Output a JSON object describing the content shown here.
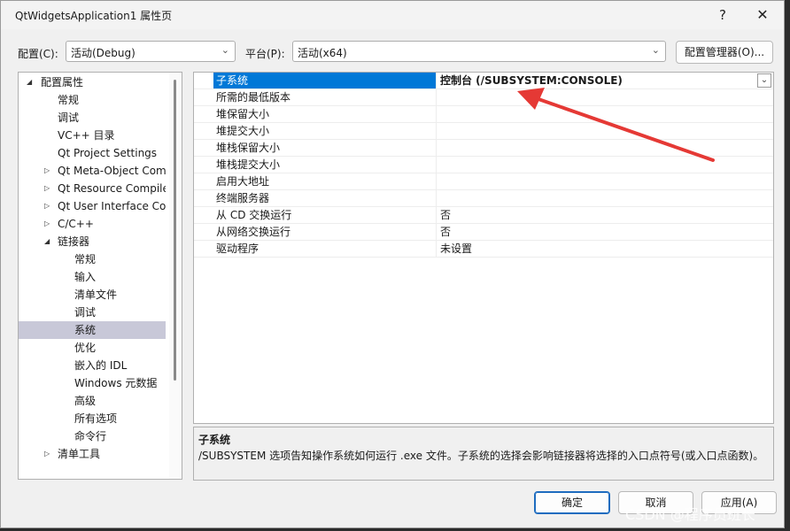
{
  "window": {
    "title": "QtWidgetsApplication1 属性页",
    "help_glyph": "?",
    "close_glyph": "✕"
  },
  "config_bar": {
    "config_label": "配置(C):",
    "config_value": "活动(Debug)",
    "platform_label": "平台(P):",
    "platform_value": "活动(x64)",
    "manager_button": "配置管理器(O)..."
  },
  "tree": {
    "items": [
      {
        "label": "配置属性",
        "expander": "◢"
      },
      {
        "label": "常规",
        "expander": ""
      },
      {
        "label": "调试",
        "expander": ""
      },
      {
        "label": "VC++ 目录",
        "expander": ""
      },
      {
        "label": "Qt Project Settings",
        "expander": ""
      },
      {
        "label": "Qt Meta-Object Com",
        "expander": "▷"
      },
      {
        "label": "Qt Resource Compile",
        "expander": "▷"
      },
      {
        "label": "Qt User Interface Co",
        "expander": "▷"
      },
      {
        "label": "C/C++",
        "expander": "▷"
      },
      {
        "label": "链接器",
        "expander": "◢"
      },
      {
        "label": "常规",
        "expander": ""
      },
      {
        "label": "输入",
        "expander": ""
      },
      {
        "label": "清单文件",
        "expander": ""
      },
      {
        "label": "调试",
        "expander": ""
      },
      {
        "label": "系统",
        "expander": ""
      },
      {
        "label": "优化",
        "expander": ""
      },
      {
        "label": "嵌入的 IDL",
        "expander": ""
      },
      {
        "label": "Windows 元数据",
        "expander": ""
      },
      {
        "label": "高级",
        "expander": ""
      },
      {
        "label": "所有选项",
        "expander": ""
      },
      {
        "label": "命令行",
        "expander": ""
      },
      {
        "label": "清单工具",
        "expander": "▷"
      }
    ]
  },
  "properties": {
    "rows": [
      {
        "name": "子系统",
        "value": "控制台 (/SUBSYSTEM:CONSOLE)"
      },
      {
        "name": "所需的最低版本",
        "value": ""
      },
      {
        "name": "堆保留大小",
        "value": ""
      },
      {
        "name": "堆提交大小",
        "value": ""
      },
      {
        "name": "堆栈保留大小",
        "value": ""
      },
      {
        "name": "堆栈提交大小",
        "value": ""
      },
      {
        "name": "启用大地址",
        "value": ""
      },
      {
        "name": "终端服务器",
        "value": ""
      },
      {
        "name": "从 CD 交换运行",
        "value": "否"
      },
      {
        "name": "从网络交换运行",
        "value": "否"
      },
      {
        "name": "驱动程序",
        "value": "未设置"
      }
    ],
    "dropdown_glyph": "⌄"
  },
  "description": {
    "title": "子系统",
    "text": "/SUBSYSTEM 选项告知操作系统如何运行 .exe 文件。子系统的选择会影响链接器将选择的入口点符号(或入口点函数)。"
  },
  "buttons": {
    "ok": "确定",
    "cancel": "取消",
    "apply": "应用(A)"
  },
  "watermark": "CSDN @程序员班长",
  "colors": {
    "selection": "#0078d7",
    "annotation_arrow": "#e53935"
  }
}
